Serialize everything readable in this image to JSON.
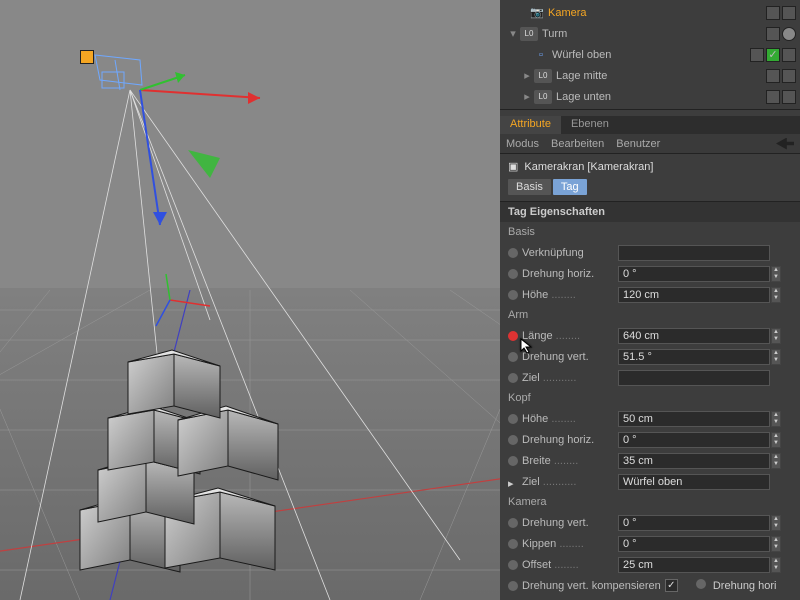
{
  "objects": {
    "kamera": "Kamera",
    "turm": "Turm",
    "wuerfel_oben": "Würfel oben",
    "lage_mitte": "Lage mitte",
    "lage_unten": "Lage unten",
    "layer_prefix": "L",
    "layer_zero": "0"
  },
  "attr_panel": {
    "tabs": {
      "attribute": "Attribute",
      "ebenen": "Ebenen"
    },
    "menu": {
      "modus": "Modus",
      "bearbeiten": "Bearbeiten",
      "benutzer": "Benutzer"
    },
    "title": "Kamerakran [Kamerakran]",
    "mode_tabs": {
      "basis": "Basis",
      "tag": "Tag"
    },
    "section_title": "Tag Eigenschaften"
  },
  "groups": {
    "basis": "Basis",
    "arm": "Arm",
    "kopf": "Kopf",
    "kamera": "Kamera"
  },
  "props": {
    "verknuepfung": {
      "label": "Verknüpfung",
      "value": ""
    },
    "drehung_horiz": {
      "label": "Drehung horiz.",
      "value": "0 °"
    },
    "hoehe_basis": {
      "label": "Höhe",
      "value": "120 cm"
    },
    "laenge": {
      "label": "Länge",
      "value": "640 cm"
    },
    "drehung_vert_arm": {
      "label": "Drehung vert.",
      "value": "51.5 °"
    },
    "ziel_arm": {
      "label": "Ziel",
      "value": ""
    },
    "hoehe_kopf": {
      "label": "Höhe",
      "value": "50 cm"
    },
    "drehung_horiz_kopf": {
      "label": "Drehung horiz.",
      "value": "0 °"
    },
    "breite": {
      "label": "Breite",
      "value": "35 cm"
    },
    "ziel_kopf": {
      "label": "Ziel",
      "value": "Würfel oben"
    },
    "drehung_vert_kam": {
      "label": "Drehung vert.",
      "value": "0 °"
    },
    "kippen": {
      "label": "Kippen",
      "value": "0 °"
    },
    "offset": {
      "label": "Offset",
      "value": "25 cm"
    },
    "drehung_vert_komp": {
      "label": "Drehung vert. kompensieren"
    },
    "drehung_hori_cut": {
      "label": "Drehung hori"
    }
  },
  "dots": "........",
  "dots_short": "....",
  "dots_long": "..........."
}
